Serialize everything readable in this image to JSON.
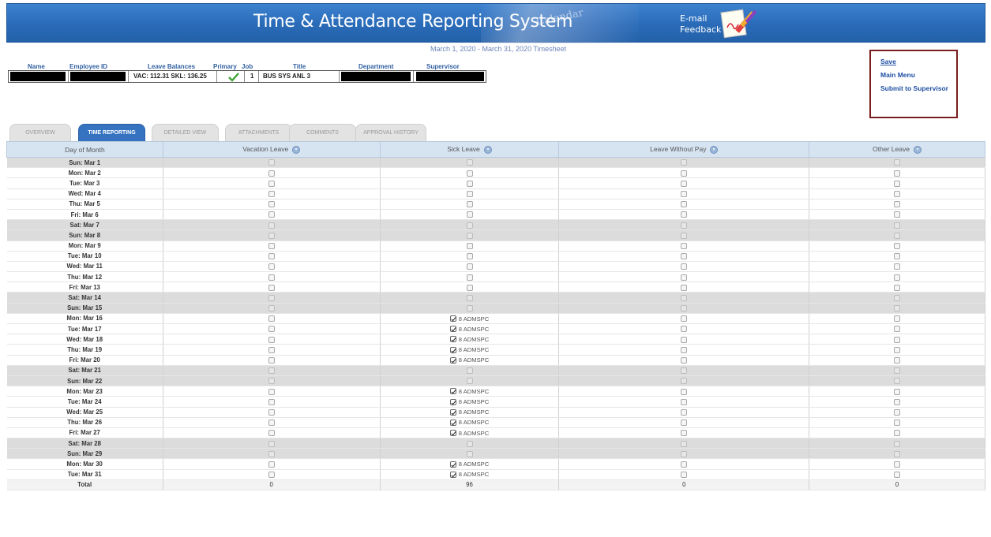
{
  "header": {
    "title": "Time & Attendance Reporting System",
    "decor_text": "Calendar",
    "email_line1": "E-mail",
    "email_line2": "Feedback",
    "period": "March 1, 2020 - March 31, 2020 Timesheet"
  },
  "employee": {
    "labels": {
      "name": "Name",
      "employee_id": "Employee ID",
      "leave_balances": "Leave Balances",
      "primary": "Primary",
      "job": "Job",
      "title": "Title",
      "department": "Department",
      "supervisor": "Supervisor"
    },
    "leave_balances": "VAC: 112.31  SKL: 136.25",
    "job": "1",
    "title": "BUS SYS ANL 3"
  },
  "actions": {
    "save": "Save",
    "main_menu": "Main Menu",
    "submit": "Submit to Supervisor"
  },
  "tabs": [
    {
      "label": "OVERVIEW",
      "active": false
    },
    {
      "label": "TIME REPORTING",
      "active": true
    },
    {
      "label": "DETAILED VIEW",
      "active": false
    },
    {
      "label": "ATTACHMENTS",
      "active": false
    },
    {
      "label": "COMMENTS",
      "active": false
    },
    {
      "label": "APPROVAL HISTORY",
      "active": false
    }
  ],
  "grid": {
    "columns": [
      "Day of Month",
      "Vacation Leave",
      "Sick Leave",
      "Leave Without Pay",
      "Other Leave"
    ],
    "sick_code": "8 ADMSPC",
    "rows": [
      {
        "day": "Sun: Mar 1",
        "weekend": true,
        "sick": false
      },
      {
        "day": "Mon: Mar 2",
        "weekend": false,
        "sick": false
      },
      {
        "day": "Tue: Mar 3",
        "weekend": false,
        "sick": false
      },
      {
        "day": "Wed: Mar 4",
        "weekend": false,
        "sick": false
      },
      {
        "day": "Thu: Mar 5",
        "weekend": false,
        "sick": false
      },
      {
        "day": "Fri: Mar 6",
        "weekend": false,
        "sick": false
      },
      {
        "day": "Sat: Mar 7",
        "weekend": true,
        "sick": false
      },
      {
        "day": "Sun: Mar 8",
        "weekend": true,
        "sick": false
      },
      {
        "day": "Mon: Mar 9",
        "weekend": false,
        "sick": false
      },
      {
        "day": "Tue: Mar 10",
        "weekend": false,
        "sick": false
      },
      {
        "day": "Wed: Mar 11",
        "weekend": false,
        "sick": false
      },
      {
        "day": "Thu: Mar 12",
        "weekend": false,
        "sick": false
      },
      {
        "day": "Fri: Mar 13",
        "weekend": false,
        "sick": false
      },
      {
        "day": "Sat: Mar 14",
        "weekend": true,
        "sick": false
      },
      {
        "day": "Sun: Mar 15",
        "weekend": true,
        "sick": false
      },
      {
        "day": "Mon: Mar 16",
        "weekend": false,
        "sick": true
      },
      {
        "day": "Tue: Mar 17",
        "weekend": false,
        "sick": true
      },
      {
        "day": "Wed: Mar 18",
        "weekend": false,
        "sick": true
      },
      {
        "day": "Thu: Mar 19",
        "weekend": false,
        "sick": true
      },
      {
        "day": "Fri: Mar 20",
        "weekend": false,
        "sick": true
      },
      {
        "day": "Sat: Mar 21",
        "weekend": true,
        "sick": false
      },
      {
        "day": "Sun: Mar 22",
        "weekend": true,
        "sick": false
      },
      {
        "day": "Mon: Mar 23",
        "weekend": false,
        "sick": true
      },
      {
        "day": "Tue: Mar 24",
        "weekend": false,
        "sick": true
      },
      {
        "day": "Wed: Mar 25",
        "weekend": false,
        "sick": true
      },
      {
        "day": "Thu: Mar 26",
        "weekend": false,
        "sick": true
      },
      {
        "day": "Fri: Mar 27",
        "weekend": false,
        "sick": true
      },
      {
        "day": "Sat: Mar 28",
        "weekend": true,
        "sick": false
      },
      {
        "day": "Sun: Mar 29",
        "weekend": true,
        "sick": false
      },
      {
        "day": "Mon: Mar 30",
        "weekend": false,
        "sick": true
      },
      {
        "day": "Tue: Mar 31",
        "weekend": false,
        "sick": true
      }
    ],
    "totals": {
      "label": "Total",
      "vacation": "0",
      "sick": "96",
      "lwop": "0",
      "other": "0"
    }
  }
}
